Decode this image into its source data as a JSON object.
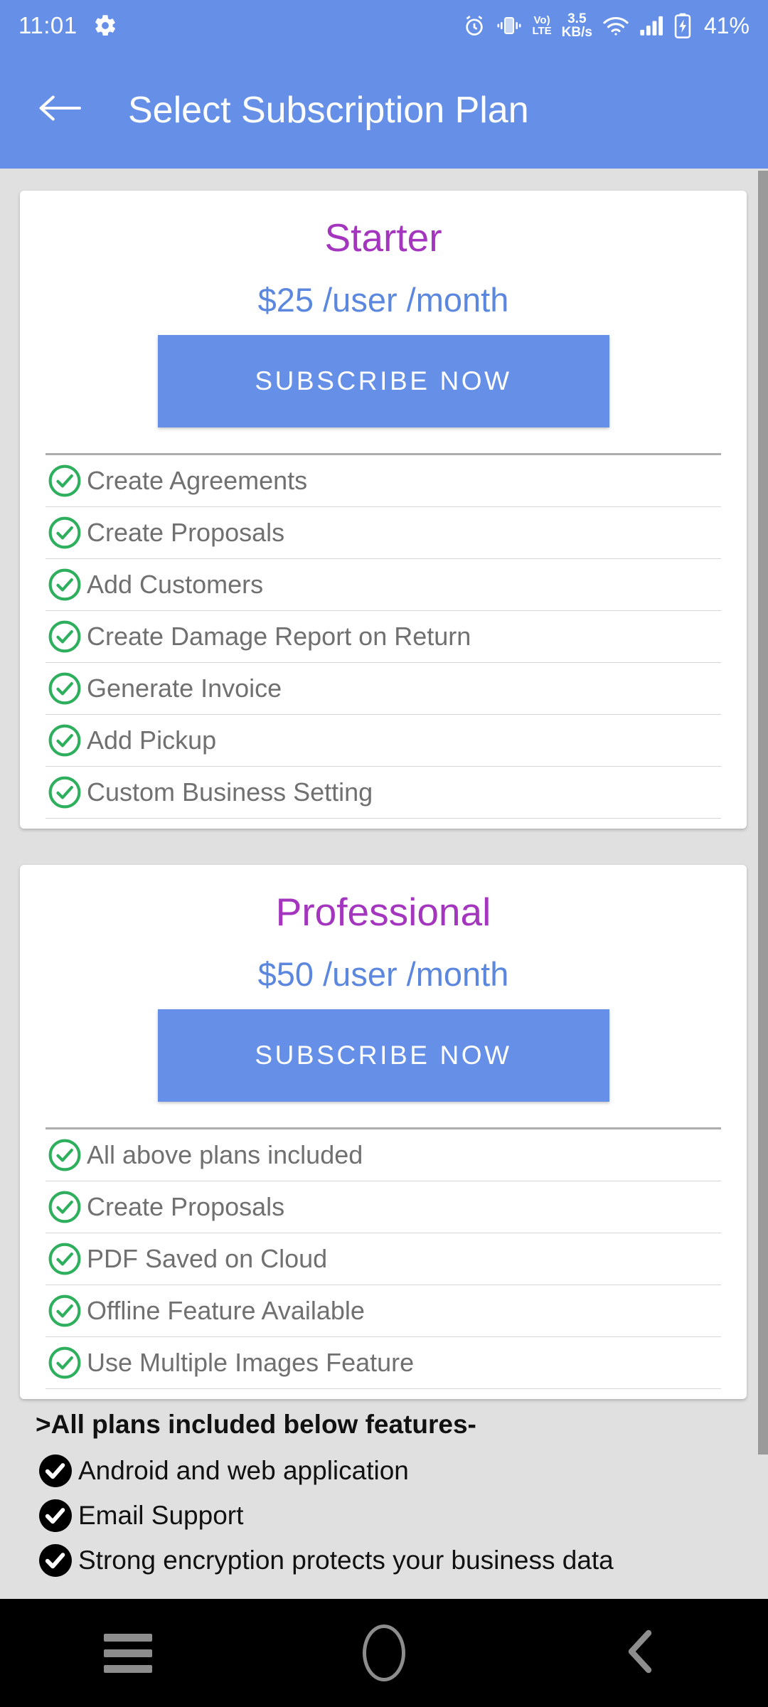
{
  "status_bar": {
    "time": "11:01",
    "settings_icon": "gear-icon",
    "alarm_icon": "alarm-clock-icon",
    "vibrate_icon": "vibrate-icon",
    "volte_top": "Vo)",
    "volte_bottom": "LTE",
    "net_speed_value": "3.5",
    "net_speed_unit": "KB/s",
    "wifi_icon": "wifi-icon",
    "signal_icon": "cellular-signal-icon",
    "battery_icon": "battery-charging-icon",
    "battery_percent": "41%"
  },
  "app_bar": {
    "back_icon": "arrow-left-icon",
    "title": "Select Subscription Plan",
    "background": "#6690e8"
  },
  "colors": {
    "accent_blue": "#6690e8",
    "price_blue": "#5b87de",
    "plan_title_purple": "#a435be",
    "check_green": "#2eaf5d",
    "page_background": "#e0e0e0",
    "card_background": "#ffffff",
    "feature_text": "#707070"
  },
  "plans": [
    {
      "title": "Starter",
      "price": "$25 /user /month",
      "subscribe_label": "SUBSCRIBE NOW",
      "features": [
        "Create Agreements",
        "Create Proposals",
        "Add Customers",
        "Create Damage Report on Return",
        "Generate Invoice",
        "Add Pickup",
        "Custom Business Setting"
      ]
    },
    {
      "title": "Professional",
      "price": "$50 /user /month",
      "subscribe_label": "SUBSCRIBE NOW",
      "features": [
        "All above plans included",
        "Create Proposals",
        "PDF Saved on Cloud",
        "Offline Feature Available",
        "Use Multiple Images Feature"
      ]
    }
  ],
  "all_plans_section": {
    "heading": ">All plans included below features-",
    "items": [
      "Android and web application",
      "Email Support",
      "Strong encryption protects your business data"
    ]
  },
  "nav_bar": {
    "recents_icon": "menu-recents-icon",
    "home_icon": "home-circle-icon",
    "back_icon": "chevron-left-icon"
  },
  "scrollbar": {
    "visible": true,
    "color": "#9a9a9a"
  }
}
